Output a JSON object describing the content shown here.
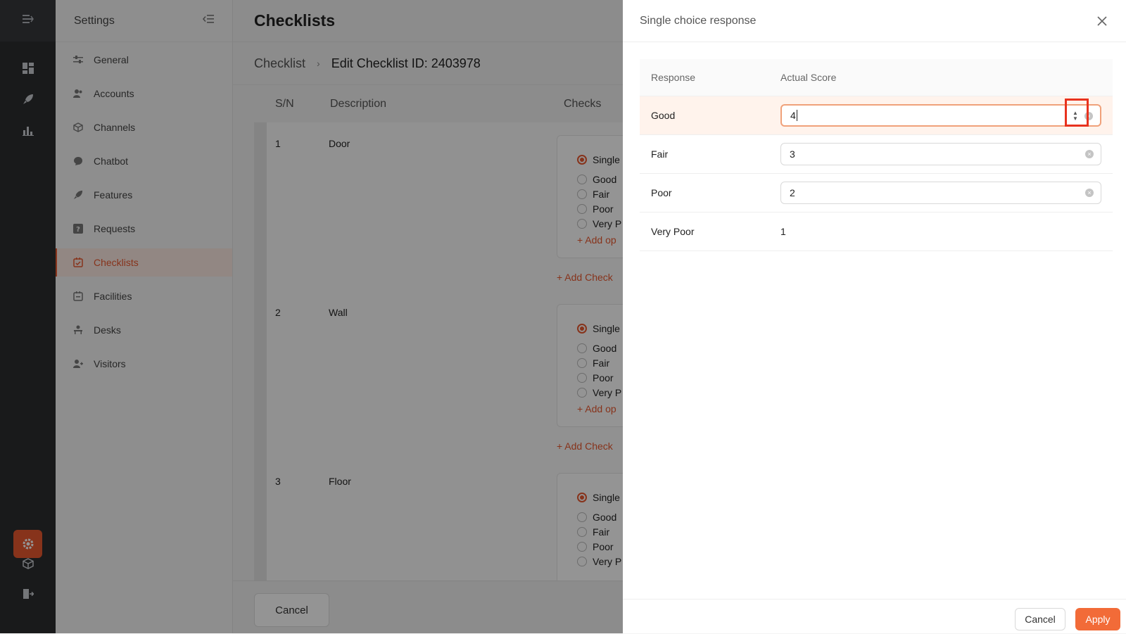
{
  "rail": {
    "icons": [
      "menu-collapse-icon",
      "dashboard-icon",
      "rocket-icon",
      "chart-icon",
      "settings-icon",
      "box-icon",
      "logout-icon"
    ]
  },
  "settings_nav": {
    "title": "Settings",
    "items": [
      {
        "label": "General",
        "icon": "sliders-icon",
        "active": false
      },
      {
        "label": "Accounts",
        "icon": "users-icon",
        "active": false
      },
      {
        "label": "Channels",
        "icon": "cube-icon",
        "active": false
      },
      {
        "label": "Chatbot",
        "icon": "chat-icon",
        "active": false
      },
      {
        "label": "Features",
        "icon": "rocket-icon",
        "active": false
      },
      {
        "label": "Requests",
        "icon": "question-icon",
        "active": false
      },
      {
        "label": "Checklists",
        "icon": "checklist-icon",
        "active": true
      },
      {
        "label": "Facilities",
        "icon": "calendar-icon",
        "active": false
      },
      {
        "label": "Desks",
        "icon": "desk-icon",
        "active": false
      },
      {
        "label": "Visitors",
        "icon": "visitor-icon",
        "active": false
      }
    ]
  },
  "main": {
    "title": "Checklists",
    "breadcrumb": {
      "root": "Checklist",
      "current": "Edit Checklist ID: 2403978"
    },
    "columns": {
      "sn": "S/N",
      "description": "Description",
      "checks": "Checks"
    },
    "rows": [
      {
        "sn": "1",
        "description": "Door",
        "type": "Single",
        "options": [
          "Good",
          "Fair",
          "Poor",
          "Very P"
        ],
        "add_option": "+ Add op",
        "add_check": "+ Add Check"
      },
      {
        "sn": "2",
        "description": "Wall",
        "type": "Single",
        "options": [
          "Good",
          "Fair",
          "Poor",
          "Very P"
        ],
        "add_option": "+ Add op",
        "add_check": "+ Add Check"
      },
      {
        "sn": "3",
        "description": "Floor",
        "type": "Single",
        "options": [
          "Good",
          "Fair",
          "Poor",
          "Very P"
        ],
        "add_option": "+ Add op",
        "add_check": ""
      }
    ],
    "cancel_label": "Cancel"
  },
  "drawer": {
    "title": "Single choice response",
    "columns": {
      "response": "Response",
      "score": "Actual Score"
    },
    "rows": [
      {
        "response": "Good",
        "score": "4"
      },
      {
        "response": "Fair",
        "score": "3"
      },
      {
        "response": "Poor",
        "score": "2"
      },
      {
        "response": "Very Poor",
        "score": "1"
      }
    ],
    "cancel_label": "Cancel",
    "apply_label": "Apply"
  },
  "colors": {
    "accent": "#e8582f",
    "apply": "#f26b38",
    "highlight_box": "#e8321e"
  }
}
